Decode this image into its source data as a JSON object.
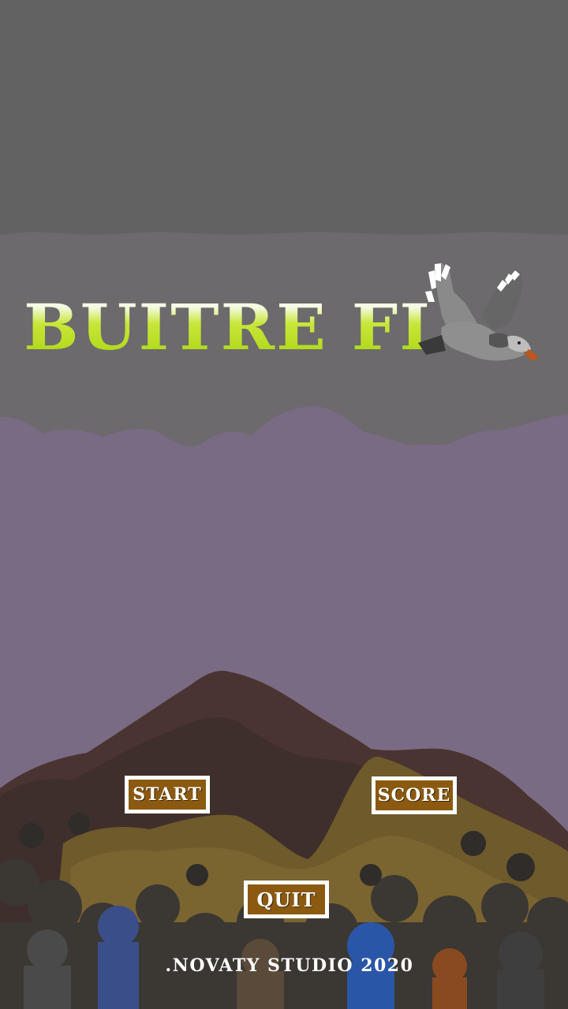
{
  "game": {
    "title": "BUITRE FLY",
    "vulture_icon": "vulture-icon"
  },
  "menu": {
    "start_label": "START",
    "score_label": "SCORE",
    "quit_label": "QUIT"
  },
  "footer": {
    "credit": ".NOVATY STUDIO 2020"
  },
  "colors": {
    "sky_top": "#626262",
    "sky_band": "#6c6a6c",
    "clouds": "#796b83",
    "title_green": "#a9d40f",
    "button_fill": "#8b5a10",
    "button_border": "#ffffff"
  }
}
